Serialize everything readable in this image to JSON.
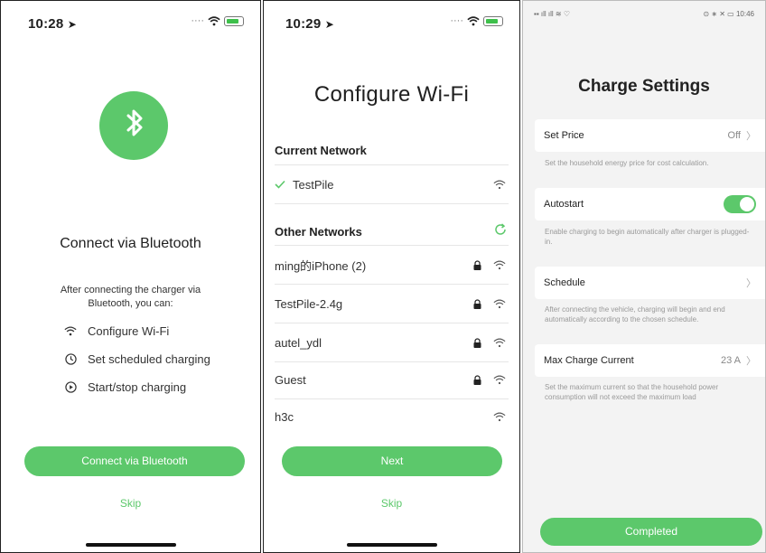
{
  "panel1": {
    "status_time": "10:28",
    "title": "Connect via Bluetooth",
    "description": "After connecting the charger via Bluetooth, you can:",
    "features": [
      {
        "icon": "wifi-icon",
        "label": "Configure Wi-Fi"
      },
      {
        "icon": "clock-icon",
        "label": "Set scheduled charging"
      },
      {
        "icon": "play-circle-icon",
        "label": "Start/stop charging"
      }
    ],
    "primary_button": "Connect via Bluetooth",
    "skip": "Skip",
    "accent": "#5cc86b"
  },
  "panel2": {
    "status_time": "10:29",
    "title": "Configure Wi-Fi",
    "current_network_header": "Current Network",
    "current_network": "TestPile",
    "other_networks_header": "Other Networks",
    "networks": [
      {
        "name": "ming的iPhone (2)",
        "locked": true
      },
      {
        "name": "TestPile-2.4g",
        "locked": true
      },
      {
        "name": "autel_ydl",
        "locked": true
      },
      {
        "name": "Guest",
        "locked": true
      },
      {
        "name": "h3c",
        "locked": false
      }
    ],
    "next_button": "Next",
    "skip": "Skip"
  },
  "panel3": {
    "status_time": "10:46",
    "title": "Charge Settings",
    "settings": [
      {
        "label": "Set Price",
        "value": "Off",
        "hint": "Set the household energy price for cost calculation."
      },
      {
        "label": "Autostart",
        "value": "on",
        "hint": "Enable charging to begin automatically after charger is plugged-in."
      },
      {
        "label": "Schedule",
        "value": "",
        "hint": "After connecting the vehicle, charging will begin and end automatically according to the chosen schedule."
      },
      {
        "label": "Max Charge Current",
        "value": "23 A",
        "hint": "Set the maximum current so that the household power consumption will not exceed the maximum load"
      }
    ],
    "completed_button": "Completed"
  }
}
